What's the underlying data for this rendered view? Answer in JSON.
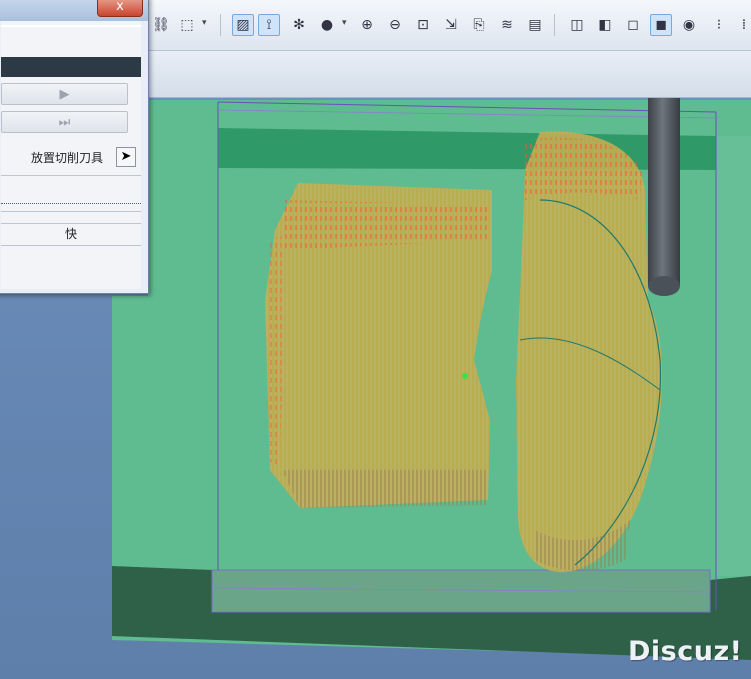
{
  "toolbar": {
    "icons": [
      "binoculars-icon",
      "dashed-select-icon",
      "view-display-icon",
      "datum-axis-icon",
      "spin-center-icon",
      "shading-sphere-icon",
      "zoom-in-icon",
      "zoom-out-icon",
      "refit-icon",
      "cursor-datum-icon",
      "annotation-icon",
      "layers-icon",
      "saved-view-icon",
      "wireframe-icon",
      "hidden-line-icon",
      "no-hidden-icon",
      "shaded-icon",
      "enhanced-realism-icon",
      "ribbon-icon"
    ],
    "accent_color": "#7aa7dc"
  },
  "dialog": {
    "close_label": "x",
    "play_label": "▶",
    "skip_label": "⏭",
    "place_tool_label": "放置切削刀具",
    "fast_label": "快"
  },
  "scene": {
    "base_color": "#5fbb90",
    "wall_color": "#2f9a68",
    "toolpath_color": "#b9a846",
    "highlight_color": "#ff5533",
    "cutter_color": "#4a5158"
  },
  "watermark": "Discuz!"
}
